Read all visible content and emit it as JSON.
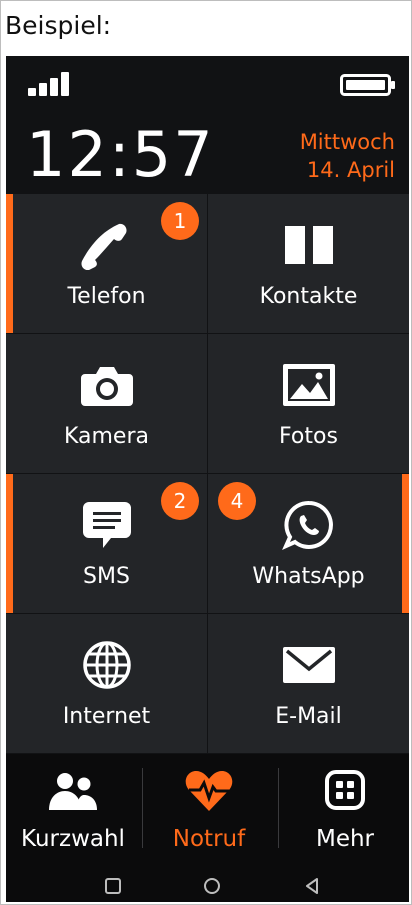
{
  "caption": "Beispiel:",
  "status": {
    "time": "12:57",
    "weekday": "Mittwoch",
    "date": "14. April"
  },
  "colors": {
    "accent": "#ff6a1a",
    "background": "#111214",
    "tile": "#232528",
    "text": "#ffffff"
  },
  "tiles": [
    {
      "label": "Telefon",
      "icon": "phone-icon",
      "badge": "1"
    },
    {
      "label": "Kontakte",
      "icon": "contacts-book-icon"
    },
    {
      "label": "Kamera",
      "icon": "camera-icon"
    },
    {
      "label": "Fotos",
      "icon": "photos-icon"
    },
    {
      "label": "SMS",
      "icon": "sms-icon",
      "badge": "2"
    },
    {
      "label": "WhatsApp",
      "icon": "whatsapp-icon",
      "badge": "4"
    },
    {
      "label": "Internet",
      "icon": "globe-icon"
    },
    {
      "label": "E-Mail",
      "icon": "mail-icon"
    }
  ],
  "bottom_nav": [
    {
      "label": "Kurzwahl",
      "icon": "people-icon"
    },
    {
      "label": "Notruf",
      "icon": "heart-pulse-icon"
    },
    {
      "label": "Mehr",
      "icon": "grid-icon"
    }
  ],
  "system_nav": [
    "square-recent-icon",
    "circle-home-icon",
    "triangle-back-icon"
  ]
}
